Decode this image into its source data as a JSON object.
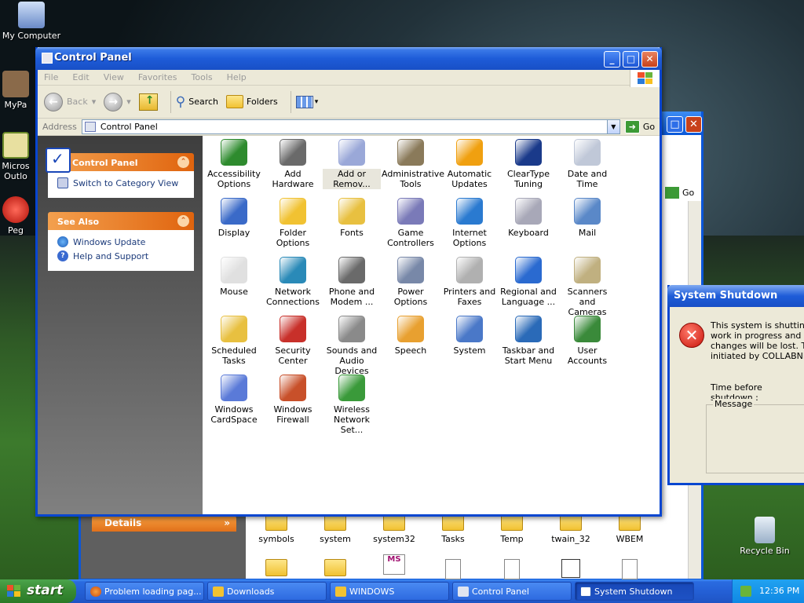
{
  "desktop": {
    "icons": [
      {
        "label": "My Computer"
      },
      {
        "label": "MyPa"
      },
      {
        "label": "Micros Outlo"
      },
      {
        "label": "Peg"
      },
      {
        "label": "Recycle Bin"
      }
    ]
  },
  "bg_window": {
    "details_label": "Details",
    "go_label": "Go",
    "files": [
      "symbols",
      "system",
      "system32",
      "Tasks",
      "Temp",
      "twain_32",
      "WBEM"
    ]
  },
  "window": {
    "title": "Control Panel",
    "menu": [
      "File",
      "Edit",
      "View",
      "Favorites",
      "Tools",
      "Help"
    ],
    "toolbar": {
      "back": "Back",
      "search": "Search",
      "folders": "Folders"
    },
    "address": {
      "label": "Address",
      "value": "Control Panel",
      "go": "Go"
    },
    "taskpane": {
      "cp_title": "Control Panel",
      "switch_link": "Switch to Category View",
      "see_also": "See Also",
      "links": [
        "Windows Update",
        "Help and Support"
      ]
    },
    "items": [
      {
        "l1": "Accessibility",
        "l2": "Options",
        "color": "#2e8b2e"
      },
      {
        "l1": "Add Hardware",
        "l2": "",
        "color": "#6a6a6a"
      },
      {
        "l1": "Add or",
        "l2": "Remov...",
        "color": "#9aa8d8"
      },
      {
        "l1": "Administrative",
        "l2": "Tools",
        "color": "#8a7a5a"
      },
      {
        "l1": "Automatic",
        "l2": "Updates",
        "color": "#f0a010"
      },
      {
        "l1": "ClearType",
        "l2": "Tuning",
        "color": "#1a3a8a"
      },
      {
        "l1": "Date and Time",
        "l2": "",
        "color": "#c0c8d8"
      },
      {
        "l1": "Display",
        "l2": "",
        "color": "#3a6ac8"
      },
      {
        "l1": "Folder Options",
        "l2": "",
        "color": "#f1c232"
      },
      {
        "l1": "Fonts",
        "l2": "",
        "color": "#e8c040"
      },
      {
        "l1": "Game",
        "l2": "Controllers",
        "color": "#7a7ab8"
      },
      {
        "l1": "Internet",
        "l2": "Options",
        "color": "#2a7ad0"
      },
      {
        "l1": "Keyboard",
        "l2": "",
        "color": "#a8a8b8"
      },
      {
        "l1": "Mail",
        "l2": "",
        "color": "#5a88c8"
      },
      {
        "l1": "Mouse",
        "l2": "",
        "color": "#e0e0e0"
      },
      {
        "l1": "Network",
        "l2": "Connections",
        "color": "#2a8ab8"
      },
      {
        "l1": "Phone and",
        "l2": "Modem ...",
        "color": "#6a6a6a"
      },
      {
        "l1": "Power Options",
        "l2": "",
        "color": "#7888a8"
      },
      {
        "l1": "Printers and",
        "l2": "Faxes",
        "color": "#b0b0b0"
      },
      {
        "l1": "Regional and",
        "l2": "Language ...",
        "color": "#2a6ad0"
      },
      {
        "l1": "Scanners and",
        "l2": "Cameras",
        "color": "#c0b080"
      },
      {
        "l1": "Scheduled",
        "l2": "Tasks",
        "color": "#e8c040"
      },
      {
        "l1": "Security",
        "l2": "Center",
        "color": "#c8302a"
      },
      {
        "l1": "Sounds and",
        "l2": "Audio Devices",
        "color": "#8a8a8a"
      },
      {
        "l1": "Speech",
        "l2": "",
        "color": "#e8a030"
      },
      {
        "l1": "System",
        "l2": "",
        "color": "#4a78c8"
      },
      {
        "l1": "Taskbar and",
        "l2": "Start Menu",
        "color": "#2a6ab8"
      },
      {
        "l1": "User Accounts",
        "l2": "",
        "color": "#3a8a3a"
      },
      {
        "l1": "Windows",
        "l2": "CardSpace",
        "color": "#5a7ad8"
      },
      {
        "l1": "Windows",
        "l2": "Firewall",
        "color": "#c8502a"
      },
      {
        "l1": "Wireless",
        "l2": "Network Set...",
        "color": "#3a9a3a"
      }
    ]
  },
  "shutdown": {
    "title": "System Shutdown",
    "line1": "This system is shutting do",
    "line2": "work in progress and log o",
    "line3": "changes will be lost. This",
    "line4": "initiated by COLLABNET\\",
    "time_label": "Time before shutdown :",
    "message_label": "Message"
  },
  "taskbar": {
    "start": "start",
    "tasks": [
      "Problem loading pag...",
      "Downloads",
      "WINDOWS",
      "Control Panel",
      "System Shutdown"
    ],
    "clock": "12:36 PM"
  }
}
